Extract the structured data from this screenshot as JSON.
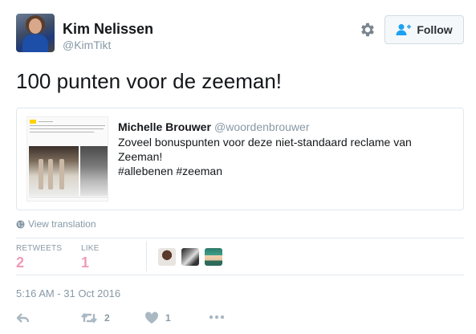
{
  "author": {
    "name": "Kim Nelissen",
    "handle": "@KimTikt"
  },
  "follow_button": {
    "label": "Follow"
  },
  "tweet": {
    "text": "100 punten voor de zeeman!"
  },
  "quoted_tweet": {
    "name": "Michelle Brouwer",
    "handle": "@woordenbrouwer",
    "lines": [
      "Zoveel bonuspunten voor deze niet-standaard reclame van",
      "Zeeman!",
      "#allebenen #zeeman"
    ]
  },
  "translation_link": "View translation",
  "stats": {
    "retweets_label": "RETWEETS",
    "retweets_value": "2",
    "likes_label": "LIKE",
    "likes_value": "1"
  },
  "timestamp": "5:16 AM - 31 Oct 2016",
  "actions": {
    "retweet_count": "2",
    "like_count": "1"
  },
  "icons": [
    "gear-icon",
    "follow-person-icon",
    "globe-icon",
    "reply-icon",
    "retweet-icon",
    "heart-icon",
    "more-icon"
  ],
  "colors": {
    "accent": "#1da1f2",
    "stat_value": "#e0245e",
    "muted": "#8899a6",
    "border": "#e1e8ed"
  }
}
